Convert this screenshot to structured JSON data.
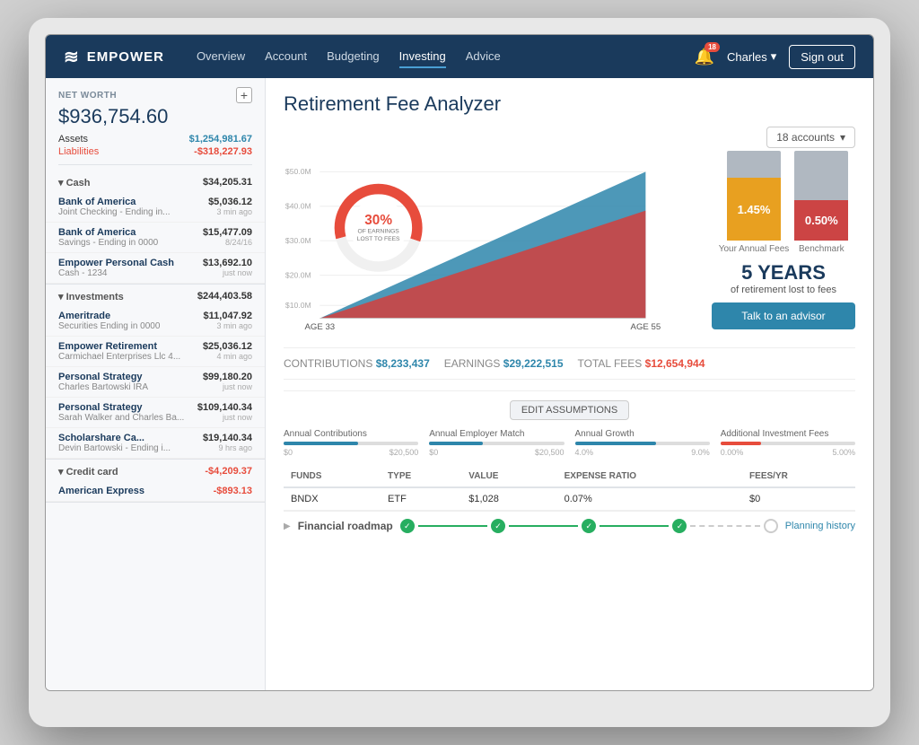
{
  "nav": {
    "logo_text": "EMPOWER",
    "links": [
      {
        "label": "Overview",
        "active": false
      },
      {
        "label": "Account",
        "active": false
      },
      {
        "label": "Budgeting",
        "active": false
      },
      {
        "label": "Investing",
        "active": true
      },
      {
        "label": "Advice",
        "active": false
      }
    ],
    "notification_count": "18",
    "user_name": "Charles",
    "sign_out": "Sign out"
  },
  "sidebar": {
    "net_worth_label": "NET WORTH",
    "net_worth_value": "$936,754.60",
    "add_btn": "+",
    "assets_label": "Assets",
    "assets_value": "$1,254,981.67",
    "liabilities_label": "Liabilities",
    "liabilities_value": "-$318,227.93",
    "groups": [
      {
        "name": "Cash",
        "total": "$34,205.31",
        "accounts": [
          {
            "name": "Bank of America",
            "sub": "Joint Checking - Ending in...",
            "value": "$5,036.12",
            "time": "3 min ago"
          },
          {
            "name": "Bank of America",
            "sub": "Savings - Ending in 0000",
            "value": "$15,477.09",
            "time": "8/24/16"
          },
          {
            "name": "Empower Personal Cash",
            "sub": "Cash - 1234",
            "value": "$13,692.10",
            "time": "just now"
          }
        ]
      },
      {
        "name": "Investments",
        "total": "$244,403.58",
        "accounts": [
          {
            "name": "Ameritrade",
            "sub": "Securities Ending in 0000",
            "value": "$11,047.92",
            "time": "3 min ago"
          },
          {
            "name": "Empower Retirement",
            "sub": "Carmichael Enterprises Llc 4...",
            "value": "$25,036.12",
            "time": "4 min ago"
          },
          {
            "name": "Personal Strategy",
            "sub": "Charles Bartowski IRA",
            "value": "$99,180.20",
            "time": "just now"
          },
          {
            "name": "Personal Strategy",
            "sub": "Sarah Walker and Charles Ba...",
            "value": "$109,140.34",
            "time": "just now"
          },
          {
            "name": "Scholarshare Ca...",
            "sub": "Devin Bartowski - Ending i...",
            "value": "$19,140.34",
            "time": "9 hrs ago"
          }
        ]
      },
      {
        "name": "Credit card",
        "total": "-$4,209.37",
        "accounts": [
          {
            "name": "American Express",
            "sub": "",
            "value": "-$893.13",
            "time": ""
          }
        ]
      }
    ]
  },
  "main": {
    "page_title": "Retirement Fee Analyzer",
    "accounts_btn": "18 accounts",
    "chart": {
      "donut_pct": "30%",
      "donut_sub": "OF EARNINGS\nLOST TO FEES",
      "age_start": "AGE 33",
      "age_end": "AGE 55",
      "y_labels": [
        "$50.0M",
        "$40.0M",
        "$30.0M",
        "$20.0M",
        "$10.0M"
      ],
      "your_annual_fees": "1.45%",
      "benchmark": "0.50%",
      "your_label": "Your Annual\nFees",
      "benchmark_label": "Benchmark",
      "years_num": "5 YEARS",
      "years_label": "of retirement lost to fees"
    },
    "stats": {
      "contributions_label": "CONTRIBUTIONS",
      "contributions_value": "$8,233,437",
      "earnings_label": "EARNINGS",
      "earnings_value": "$29,222,515",
      "total_fees_label": "TOTAL FEES",
      "total_fees_value": "$12,654,944"
    },
    "advisor_btn": "Talk to an advisor",
    "edit_assumptions_btn": "EDIT ASSUMPTIONS",
    "sliders": [
      {
        "label": "Annual Contributions",
        "min": "$0",
        "max": "$20,500",
        "fill_pct": 55
      },
      {
        "label": "Annual Employer Match",
        "min": "$0",
        "max": "$20,500",
        "fill_pct": 40
      },
      {
        "label": "Annual Growth",
        "min": "4.0%",
        "max": "9.0%",
        "fill_pct": 60
      },
      {
        "label": "Additional Investment Fees",
        "min": "0.00%",
        "max": "5.00%",
        "fill_pct": 30,
        "red": true
      }
    ],
    "table": {
      "headers": [
        "FUNDS",
        "TYPE",
        "VALUE",
        "EXPENSE RATIO",
        "FEES/YR"
      ],
      "rows": [
        {
          "fund": "BNDX",
          "type": "ETF",
          "value": "$1,028",
          "expense": "0.07%",
          "fees": "$0"
        }
      ]
    },
    "roadmap": {
      "label": "Financial roadmap",
      "history_label": "Planning history"
    }
  }
}
